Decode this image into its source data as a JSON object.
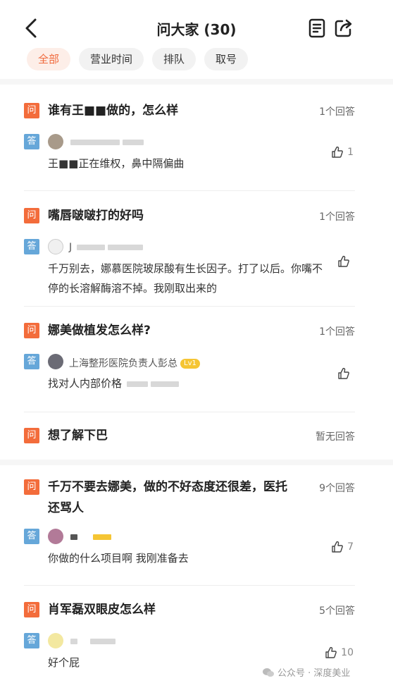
{
  "header": {
    "title": "问大家 (30)"
  },
  "tabs": [
    "全部",
    "营业时间",
    "排队",
    "取号"
  ],
  "question_label": "问",
  "answer_label": "答",
  "questions": [
    {
      "title": "谁有王■■做的，怎么样",
      "count": "1个回答",
      "answer": {
        "text": "王■■正在维权，鼻中隔偏曲",
        "likes": "1"
      }
    },
    {
      "title": "嘴唇啵啵打的好吗",
      "count": "1个回答",
      "answer": {
        "name": "J",
        "text": "千万别去，娜慕医院玻尿酸有生长因子。打了以后。你嘴不停的长溶解酶溶不掉。我刚取出来的",
        "likes": ""
      }
    },
    {
      "title": "娜美做植发怎么样?",
      "count": "1个回答",
      "answer": {
        "name": "上海整形医院负责人彭总",
        "level": "Lv1",
        "text": "找对人内部价格",
        "likes": ""
      }
    },
    {
      "title": "想了解下巴",
      "count": "暂无回答"
    },
    {
      "title": "千万不要去娜美，做的不好态度还很差，医托还骂人",
      "count": "9个回答",
      "answer": {
        "text": "你做的什么项目啊 我刚准备去",
        "likes": "7"
      }
    },
    {
      "title": "肖军磊双眼皮怎么样",
      "count": "5个回答",
      "answer": {
        "text": "好个屁",
        "likes": "10"
      }
    }
  ],
  "watermark": "公众号 · 深度美业",
  "colors": {
    "accent": "#f36c3b",
    "answer_tag": "#66a7d9",
    "tab_active_bg": "#fdeee8"
  }
}
